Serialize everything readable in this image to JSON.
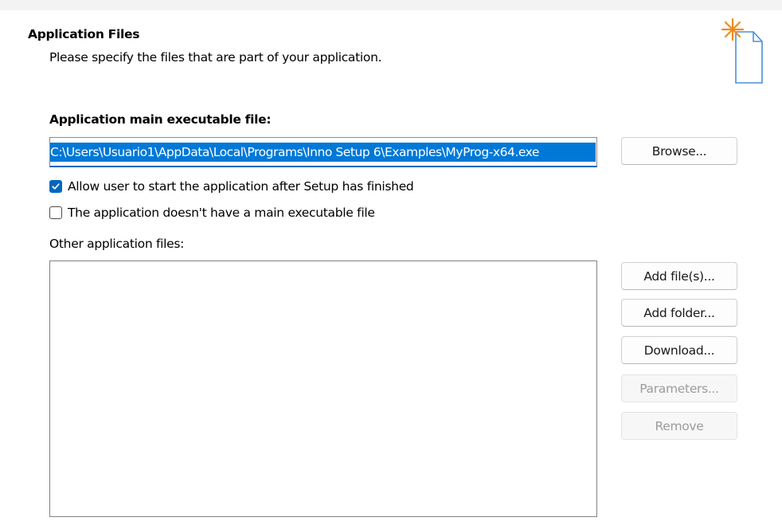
{
  "header": {
    "title": "Application Files",
    "subtitle": "Please specify the files that are part of your application.",
    "icon": "new-document-star-icon"
  },
  "main_exe": {
    "label": "Application main executable file:",
    "value": "C:\\Users\\Usuario1\\AppData\\Local\\Programs\\Inno Setup 6\\Examples\\MyProg-x64.exe",
    "browse_label": "Browse..."
  },
  "options": {
    "allow_start": {
      "label": "Allow user to start the application after Setup has finished",
      "checked": true
    },
    "no_main_exe": {
      "label": "The application doesn't have a main executable file",
      "checked": false
    }
  },
  "other_files": {
    "label": "Other application files:",
    "items": [],
    "buttons": {
      "add_files": "Add file(s)...",
      "add_folder": "Add folder...",
      "download": "Download...",
      "parameters": "Parameters...",
      "remove": "Remove"
    }
  },
  "colors": {
    "accent": "#0067c0",
    "selection": "#0078d7",
    "icon_star": "#f08a1c",
    "icon_page": "#4a8fd8"
  }
}
